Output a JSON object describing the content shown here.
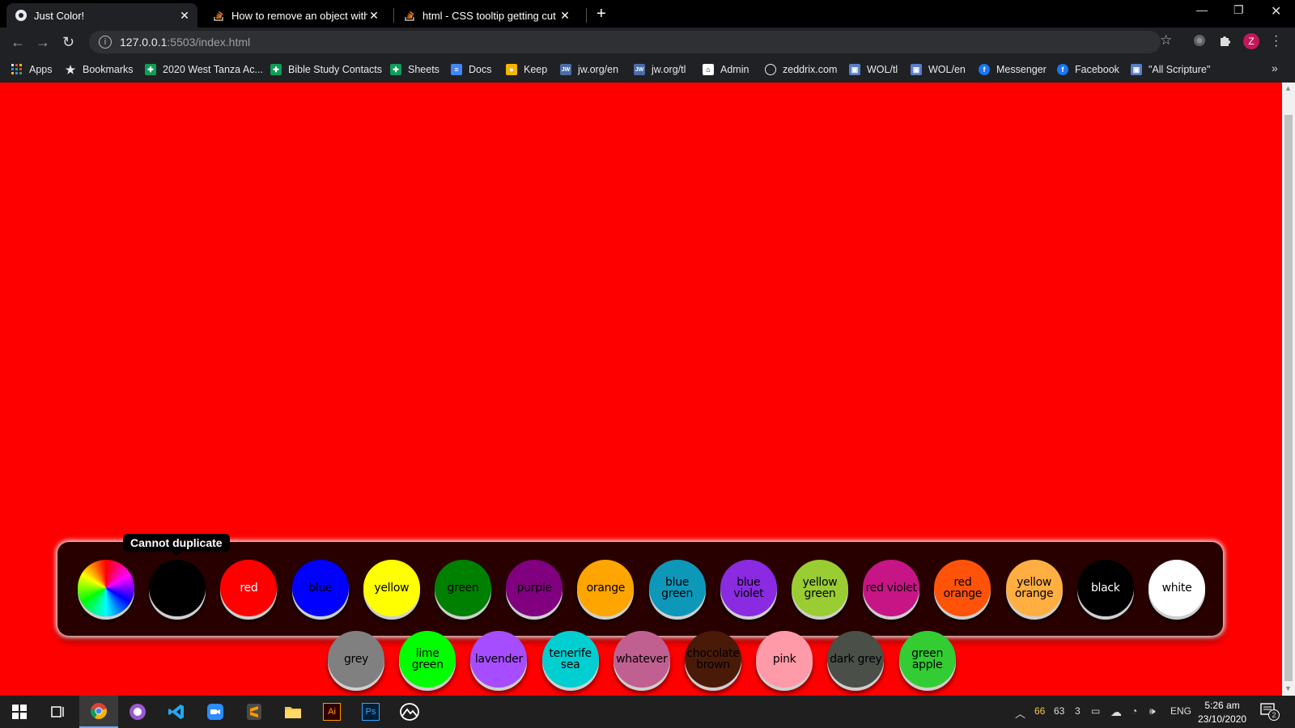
{
  "browser": {
    "tabs": [
      {
        "title": "Just Color!",
        "active": true
      },
      {
        "title": "How to remove an object with a",
        "active": false
      },
      {
        "title": "html - CSS tooltip getting cut off",
        "active": false
      }
    ],
    "url_host": "127.0.0.1",
    "url_path": ":5503/index.html",
    "profile_initial": "Z",
    "bookmarks": [
      "Apps",
      "Bookmarks",
      "2020 West Tanza Ac...",
      "Bible Study Contacts",
      "Sheets",
      "Docs",
      "Keep",
      "jw.org/en",
      "jw.org/tl",
      "Admin",
      "zeddrix.com",
      "WOL/tl",
      "WOL/en",
      "Messenger",
      "Facebook",
      "\"All Scripture\""
    ],
    "jw_icon_text": "JW"
  },
  "page": {
    "background": "#ff0000",
    "tooltip": "Cannot duplicate",
    "palette": [
      {
        "label": "",
        "color": "rainbow",
        "text_color": "#000"
      },
      {
        "label": "",
        "color": "#000000",
        "text_color": "#000"
      },
      {
        "label": "red",
        "color": "#ff0000",
        "text_color": "#ffffff"
      },
      {
        "label": "blue",
        "color": "#0000ff",
        "text_color": "#000"
      },
      {
        "label": "yellow",
        "color": "#ffff00",
        "text_color": "#000"
      },
      {
        "label": "green",
        "color": "#008000",
        "text_color": "#000"
      },
      {
        "label": "purple",
        "color": "#800080",
        "text_color": "#000"
      },
      {
        "label": "orange",
        "color": "#ffa500",
        "text_color": "#000"
      },
      {
        "label": "blue green",
        "color": "#0d98ba",
        "text_color": "#000"
      },
      {
        "label": "blue violet",
        "color": "#8a2be2",
        "text_color": "#000"
      },
      {
        "label": "yellow green",
        "color": "#9acd32",
        "text_color": "#000"
      },
      {
        "label": "red violet",
        "color": "#c71585",
        "text_color": "#000"
      },
      {
        "label": "red orange",
        "color": "#ff5309",
        "text_color": "#000"
      },
      {
        "label": "yellow orange",
        "color": "#ffae42",
        "text_color": "#000"
      },
      {
        "label": "black",
        "color": "#000000",
        "text_color": "#ffffff"
      },
      {
        "label": "white",
        "color": "#ffffff",
        "text_color": "#000"
      }
    ],
    "palette_row2": [
      {
        "label": "grey",
        "color": "#808080",
        "text_color": "#000"
      },
      {
        "label": "lime green",
        "color": "#00ff00",
        "text_color": "#000"
      },
      {
        "label": "lavender",
        "color": "#a64dff",
        "text_color": "#000"
      },
      {
        "label": "tenerife sea",
        "color": "#00ced1",
        "text_color": "#000"
      },
      {
        "label": "whatever",
        "color": "#c06090",
        "text_color": "#000"
      },
      {
        "label": "chocolate brown",
        "color": "#4a1a08",
        "text_color": "#000"
      },
      {
        "label": "pink",
        "color": "#ff9aa8",
        "text_color": "#000"
      },
      {
        "label": "dark grey",
        "color": "#4a4f48",
        "text_color": "#000"
      },
      {
        "label": "green apple",
        "color": "#33cc33",
        "text_color": "#000"
      }
    ]
  },
  "taskbar": {
    "tray_numbers": [
      "66",
      "63",
      "3"
    ],
    "language": "ENG",
    "time": "5:26 am",
    "date": "23/10/2020",
    "notification_count": "2",
    "app_icons": [
      "windows-start-icon",
      "task-view-icon",
      "chrome-icon",
      "app-purple-icon",
      "vscode-icon",
      "zoom-icon",
      "sublime-icon",
      "file-explorer-icon",
      "illustrator-icon",
      "photoshop-icon",
      "mountain-app-icon"
    ],
    "illustrator_label": "Ai",
    "photoshop_label": "Ps"
  }
}
